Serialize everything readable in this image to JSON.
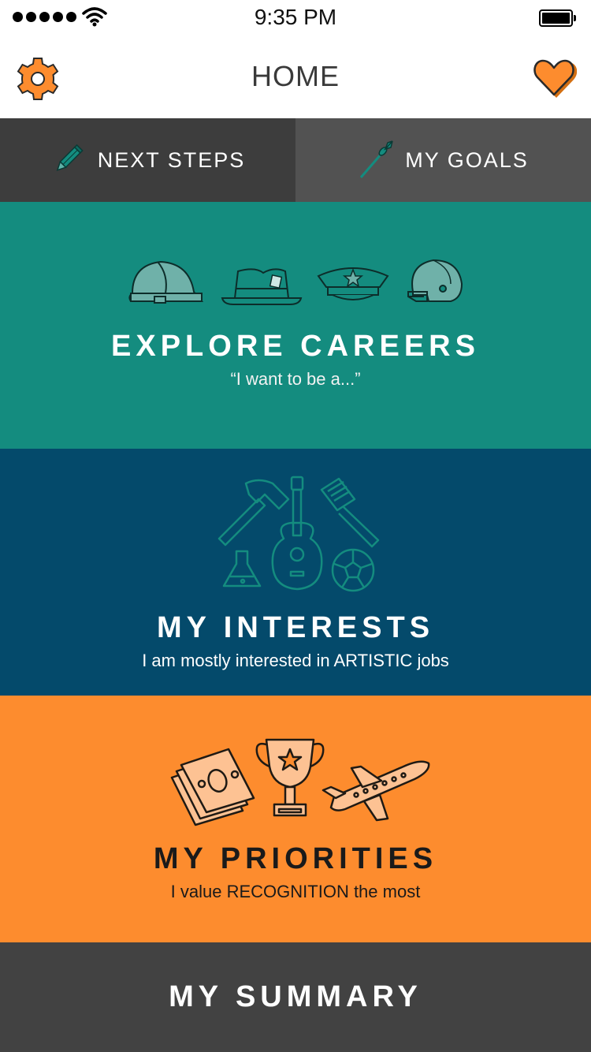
{
  "status_bar": {
    "time": "9:35 PM",
    "signal_icon": "signal-dots-icon",
    "wifi_icon": "wifi-icon",
    "battery_icon": "battery-icon"
  },
  "nav": {
    "title": "HOME",
    "settings_icon": "gear-icon",
    "favorites_icon": "heart-icon"
  },
  "tabs": [
    {
      "label": "NEXT STEPS",
      "icon": "pencil-icon"
    },
    {
      "label": "MY GOALS",
      "icon": "dart-icon"
    }
  ],
  "sections": {
    "careers": {
      "title": "EXPLORE CAREERS",
      "subtitle": "“I want to be a...”",
      "icons": [
        "hard-hat-icon",
        "fedora-hat-icon",
        "police-cap-icon",
        "football-helmet-icon"
      ]
    },
    "interests": {
      "title": "MY INTERESTS",
      "subtitle": "I am mostly interested in ARTISTIC jobs",
      "icons": [
        "hammer-icon",
        "guitar-icon",
        "spatula-icon",
        "flask-icon",
        "soccer-ball-icon"
      ]
    },
    "priorities": {
      "title": "MY PRIORITIES",
      "subtitle": "I value RECOGNITION the most",
      "icons": [
        "money-icon",
        "trophy-icon",
        "airplane-icon"
      ]
    },
    "summary": {
      "title": "MY SUMMARY"
    }
  },
  "colors": {
    "accent_orange": "#fd8c2e",
    "careers_teal": "#148c7f",
    "interests_navy": "#044a6b",
    "summary_gray": "#424242",
    "tab_dark": "#3d3d3d",
    "tab_mid": "#525252"
  }
}
